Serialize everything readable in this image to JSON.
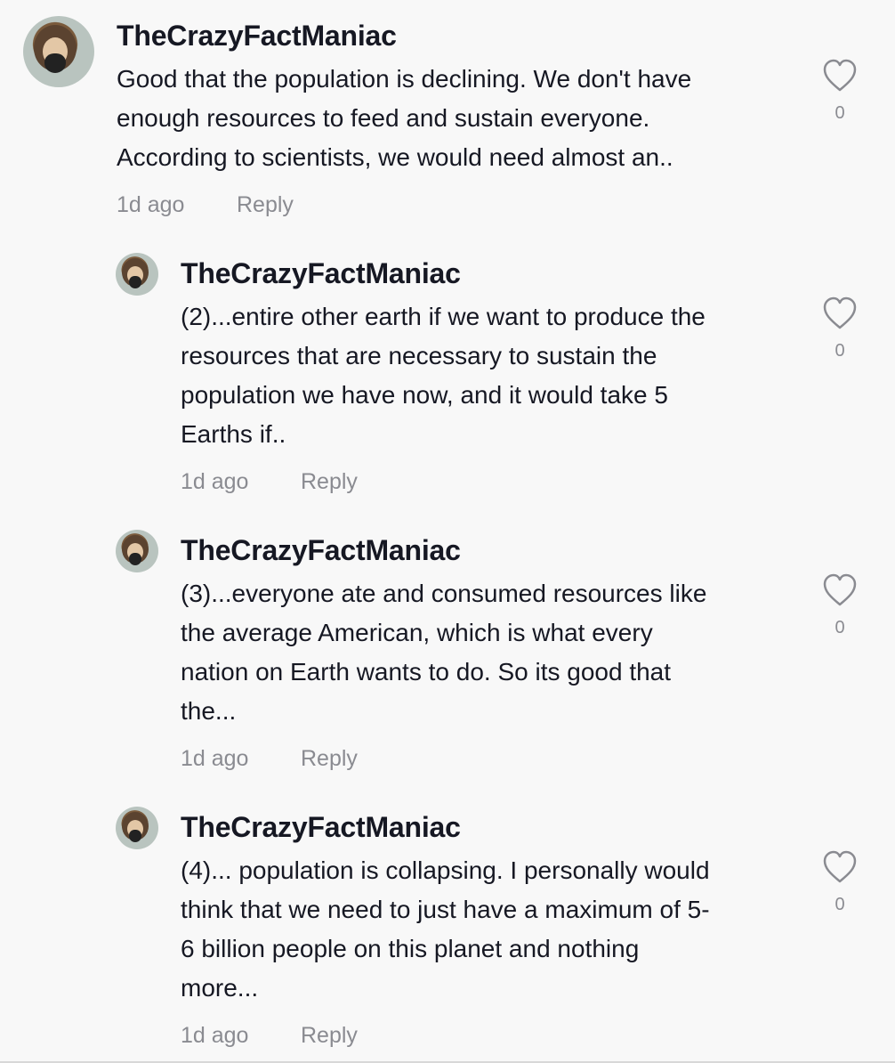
{
  "comments": [
    {
      "username": "TheCrazyFactManiac",
      "text": "Good that the population is declining. We don't have\nenough resources to feed and sustain everyone.\nAccording to scientists, we would need almost an..",
      "time": "1d ago",
      "reply": "Reply",
      "likes": "0",
      "avatar_icon": "profile-photo",
      "like_icon": "heart-outline"
    },
    {
      "username": "TheCrazyFactManiac",
      "text": "(2)...entire other earth if we want to produce the\nresources that are necessary to sustain the\npopulation we have now, and it would take 5\nEarths if..",
      "time": "1d ago",
      "reply": "Reply",
      "likes": "0",
      "avatar_icon": "profile-photo",
      "like_icon": "heart-outline"
    },
    {
      "username": "TheCrazyFactManiac",
      "text": "(3)...everyone ate and consumed resources like\nthe average American, which is what every\nnation on Earth wants to do. So its good that\nthe...",
      "time": "1d ago",
      "reply": "Reply",
      "likes": "0",
      "avatar_icon": "profile-photo",
      "like_icon": "heart-outline"
    },
    {
      "username": "TheCrazyFactManiac",
      "text": "(4)... population is collapsing. I personally would\nthink that we need to just have a maximum of 5-\n6 billion people on this planet and nothing\nmore...",
      "time": "1d ago",
      "reply": "Reply",
      "likes": "0",
      "avatar_icon": "profile-photo",
      "like_icon": "heart-outline"
    }
  ]
}
